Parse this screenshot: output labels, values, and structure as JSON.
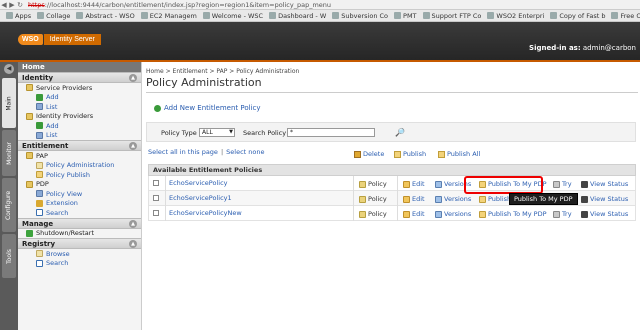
{
  "browser": {
    "url_struck": "https",
    "url_rest": "://localhost:9444/carbon/entitlement/index.jsp?region=region1&item=policy_pap_menu",
    "bookmarks": [
      "Apps",
      "Collage",
      "Abstract - WSO",
      "EC2 Managem",
      "Welcome - WSC",
      "Dashboard - W",
      "Subversion Co",
      "PMT",
      "Support FTP Co",
      "WSO2 Enterpri",
      "Copy of Fast b",
      "Free O"
    ]
  },
  "header": {
    "logo_wso": "WSO",
    "logo_product": "Identity Server",
    "signed_in_label": "Signed-in as:",
    "signed_in_user": "admin@carbon"
  },
  "vtabs": [
    "Main",
    "Monitor",
    "Configure",
    "Tools"
  ],
  "sidebar": {
    "home": "Home",
    "sections": [
      {
        "title": "Identity",
        "items": [
          {
            "label": "Service Providers",
            "level": 1,
            "icon": "folder-icon"
          },
          {
            "label": "Add",
            "level": 2,
            "icon": "add-icon"
          },
          {
            "label": "List",
            "level": 2,
            "icon": "list-icon"
          },
          {
            "label": "Identity Providers",
            "level": 1,
            "icon": "folder-icon"
          },
          {
            "label": "Add",
            "level": 2,
            "icon": "add-icon"
          },
          {
            "label": "List",
            "level": 2,
            "icon": "list-icon"
          }
        ]
      },
      {
        "title": "Entitlement",
        "items": [
          {
            "label": "PAP",
            "level": 1,
            "icon": "folder-icon"
          },
          {
            "label": "Policy Administration",
            "level": 2,
            "icon": "policy-icon"
          },
          {
            "label": "Policy Publish",
            "level": 2,
            "icon": "publish-icon"
          },
          {
            "label": "PDP",
            "level": 1,
            "icon": "folder-icon"
          },
          {
            "label": "Policy View",
            "level": 2,
            "icon": "list-icon"
          },
          {
            "label": "Extension",
            "level": 2,
            "icon": "shield-icon"
          },
          {
            "label": "Search",
            "level": 2,
            "icon": "search-icon"
          }
        ]
      },
      {
        "title": "Manage",
        "items": [
          {
            "label": "Shutdown/Restart",
            "level": 1,
            "icon": "power-icon"
          }
        ]
      },
      {
        "title": "Registry",
        "items": [
          {
            "label": "Browse",
            "level": 2,
            "icon": "browse-icon"
          },
          {
            "label": "Search",
            "level": 2,
            "icon": "search-icon"
          }
        ]
      }
    ]
  },
  "main": {
    "breadcrumb": "Home > Entitlement > PAP > Policy Administration",
    "title": "Policy Administration",
    "add_link": "Add New Entitlement Policy",
    "filter": {
      "policy_type_label": "Policy Type",
      "policy_type_value": "ALL",
      "search_label": "Search Policy",
      "search_value": "*"
    },
    "select_all": "Select all in this page",
    "select_none": "Select none",
    "bulk": {
      "delete": "Delete",
      "publish": "Publish",
      "publish_all": "Publish All"
    },
    "table_title": "Available Entitlement Policies",
    "rows": [
      {
        "name": "EchoServicePolicy",
        "type": "Policy"
      },
      {
        "name": "EchoServicePolicy1",
        "type": "Policy"
      },
      {
        "name": "EchoServicePolicyNew",
        "type": "Policy"
      }
    ],
    "actions": {
      "edit": "Edit",
      "versions": "Versions",
      "publish": "Publish To My PDP",
      "try": "Try",
      "view": "View Status"
    },
    "tooltip": "Publish To My PDP"
  },
  "colors": {
    "accent": "#f08a1c",
    "link": "#2a5db0",
    "highlight": "#e00000"
  }
}
